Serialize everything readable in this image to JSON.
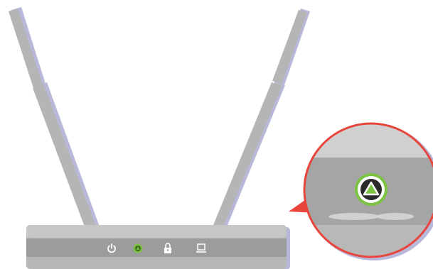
{
  "illustration": {
    "device": "wireless-router",
    "antenna_count": 2,
    "status_lights": [
      {
        "icon": "power-icon",
        "color": "#ffffff",
        "active": false
      },
      {
        "icon": "wireless-status-icon",
        "color": "#7cc243",
        "active": true
      },
      {
        "icon": "lock-icon",
        "color": "#ffffff",
        "active": false
      },
      {
        "icon": "ethernet-icon",
        "color": "#ffffff",
        "active": false
      }
    ],
    "callout": {
      "magnified_icon": "wireless-status-icon",
      "border_color": "#e8453c",
      "icon_color": "#7cc243"
    }
  },
  "colors": {
    "body": "#b7b7b7",
    "body_band": "#9a9a9a",
    "shadow": "#b8b8d8",
    "accent_green": "#7cc243",
    "callout_red": "#e8453c"
  }
}
